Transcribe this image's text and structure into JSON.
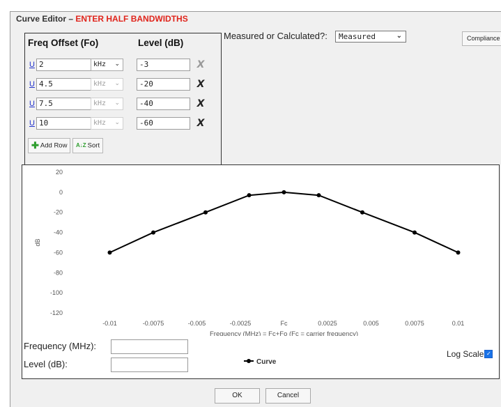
{
  "dialog": {
    "title_prefix": "Curve Editor –",
    "title_warning": "ENTER HALF BANDWIDTHS"
  },
  "table": {
    "headers": {
      "freq_offset": "Freq Offset (Fo)",
      "level": "Level (dB)"
    },
    "rows": [
      {
        "link": "U",
        "freq": "2",
        "unit": "kHz",
        "level": "-3",
        "delete": "X"
      },
      {
        "link": "U",
        "freq": "4.5",
        "unit": "kHz",
        "level": "-20",
        "delete": "X"
      },
      {
        "link": "U",
        "freq": "7.5",
        "unit": "kHz",
        "level": "-40",
        "delete": "X"
      },
      {
        "link": "U",
        "freq": "10",
        "unit": "kHz",
        "level": "-60",
        "delete": "X"
      }
    ],
    "add_row_label": "Add Row",
    "sort_label": "Sort",
    "add_row_icon": "plus-icon",
    "sort_icon": "az-sort-icon"
  },
  "measured": {
    "label": "Measured or Calculated?:",
    "value": "Measured"
  },
  "compliance_label": "Compliance",
  "chart_data": {
    "type": "line",
    "title": "",
    "xlabel": "Frequency (MHz) = Fc+Fo (Fc = carrier frequency)",
    "ylabel": "dB",
    "x_ticks": [
      -0.01,
      -0.0075,
      -0.005,
      -0.0025,
      0,
      0.0025,
      0.005,
      0.0075,
      0.01
    ],
    "x_tick_labels": [
      "-0.01",
      "-0.0075",
      "-0.005",
      "-0.0025",
      "Fc",
      "0.0025",
      "0.005",
      "0.0075",
      "0.01"
    ],
    "y_ticks": [
      20,
      0,
      -20,
      -40,
      -60,
      -80,
      -100,
      -120
    ],
    "xlim": [
      -0.0115,
      0.0115
    ],
    "ylim": [
      -120,
      20
    ],
    "grid": false,
    "legend_position": "bottom-center",
    "series": [
      {
        "name": "Curve",
        "color": "#000000",
        "x": [
          -0.01,
          -0.0075,
          -0.0045,
          -0.002,
          0,
          0.002,
          0.0045,
          0.0075,
          0.01
        ],
        "y": [
          -60,
          -40,
          -20,
          -3,
          0,
          -3,
          -20,
          -40,
          -60
        ]
      }
    ]
  },
  "fields": {
    "frequency_label": "Frequency (MHz):",
    "frequency_value": "",
    "level_label": "Level (dB):",
    "level_value": ""
  },
  "log_scale": {
    "label": "Log Scale",
    "checked": true
  },
  "buttons": {
    "ok": "OK",
    "cancel": "Cancel"
  },
  "colors": {
    "warning": "#e0241b",
    "link": "#2233cc",
    "checkbox": "#1a73e8"
  }
}
